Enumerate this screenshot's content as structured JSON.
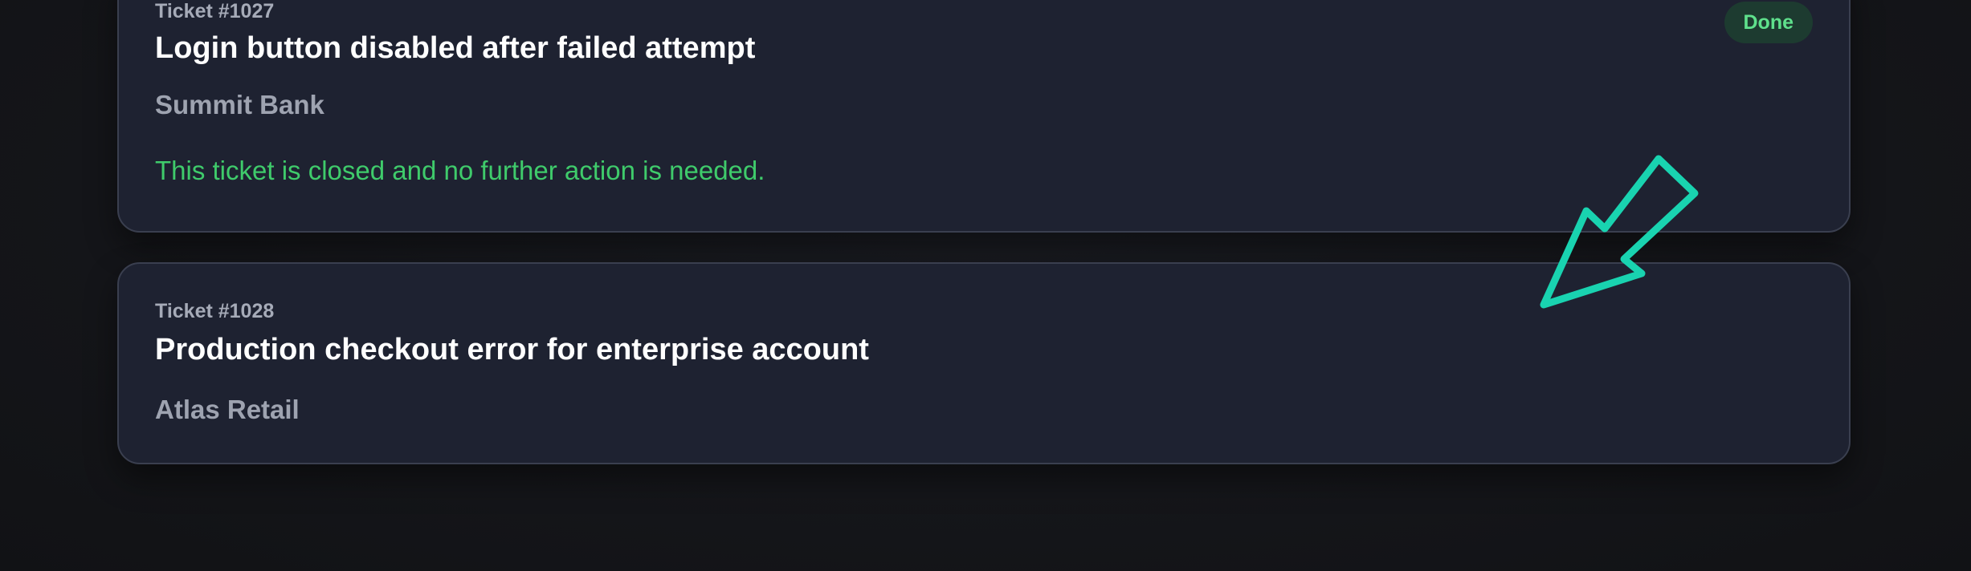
{
  "tickets": [
    {
      "id_label": "Ticket #1027",
      "title": "Login button disabled after failed attempt",
      "company": "Summit Bank",
      "status": "Done",
      "note": "This ticket is closed and no further action is needed."
    },
    {
      "id_label": "Ticket #1028",
      "title": "Production checkout error for enterprise account",
      "company": "Atlas Retail"
    }
  ],
  "colors": {
    "background": "#141519",
    "card": "#1e2231",
    "card_border": "#3a3f4f",
    "success_text": "#3fcb6b",
    "done_badge_bg": "#1d3b30",
    "done_badge_text": "#5fe08c",
    "arrow": "#19d3b0"
  },
  "annotation": {
    "icon": "arrow-pointer-icon"
  }
}
